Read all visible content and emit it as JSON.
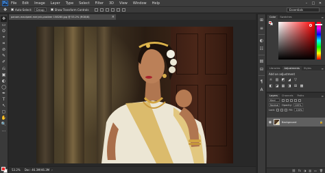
{
  "app": {
    "logo": "Ps"
  },
  "menu": [
    "File",
    "Edit",
    "Image",
    "Layer",
    "Type",
    "Select",
    "Filter",
    "3D",
    "View",
    "Window",
    "Help"
  ],
  "window_controls": [
    "–",
    "□",
    "✕"
  ],
  "options_bar": {
    "tool_icon": "move-icon",
    "auto_select_label": "Auto-Select:",
    "auto_select_value": "Group",
    "show_transform_label": "Show Transform Controls",
    "workspace": "Essentials"
  },
  "document": {
    "tab_title": "panam-mavipeel-merysh-pradeer 158280.jpg @ 53.2% (RGB/8)",
    "close": "×"
  },
  "status": {
    "zoom": "53.2%",
    "doc_info": "Doc: 46.3M/46.3M",
    "arrow": "›"
  },
  "tools": [
    "✥",
    "▭",
    "ʘ",
    "⌖",
    "⌗",
    "⊘",
    "✎",
    "✐",
    "⎌",
    "▣",
    "◐",
    "◯",
    "✒",
    "T",
    "↖",
    "▢",
    "✋",
    "🔍",
    "…"
  ],
  "right_icons": [
    "⊞",
    "≡",
    "◐",
    "☷",
    "▤",
    "⊟",
    "¶",
    "A"
  ],
  "panels": {
    "color": {
      "tabs": [
        "Color",
        "Swatches"
      ],
      "menu": "≡",
      "fg": "#e82a2a",
      "bg": "#ffffff"
    },
    "adjustments": {
      "tabs": [
        "Libraries",
        "Adjustments",
        "Styles"
      ],
      "menu": "≡",
      "title": "Add an adjustment",
      "row1": [
        "☼",
        "▥",
        "◩",
        "◢",
        "▽"
      ],
      "row2": [
        "◧",
        "◪",
        "▦",
        "◨",
        "⊞",
        "▩"
      ]
    },
    "layers": {
      "tabs": [
        "Layers",
        "Channels",
        "Paths"
      ],
      "menu": "≡",
      "kind": "Kind",
      "blend": "Normal",
      "opacity_label": "Opacity:",
      "opacity_value": "100%",
      "lock_label": "Lock:",
      "fill_label": "Fill:",
      "fill_value": "100%",
      "layer_name": "Background",
      "lock_icon": "🔒",
      "footer_icons": [
        "⛓",
        "fx",
        "◑",
        "▥",
        "▭",
        "🗑"
      ]
    }
  },
  "colors": {
    "accent": "#2a69b8",
    "fg": "#e82a2a"
  }
}
